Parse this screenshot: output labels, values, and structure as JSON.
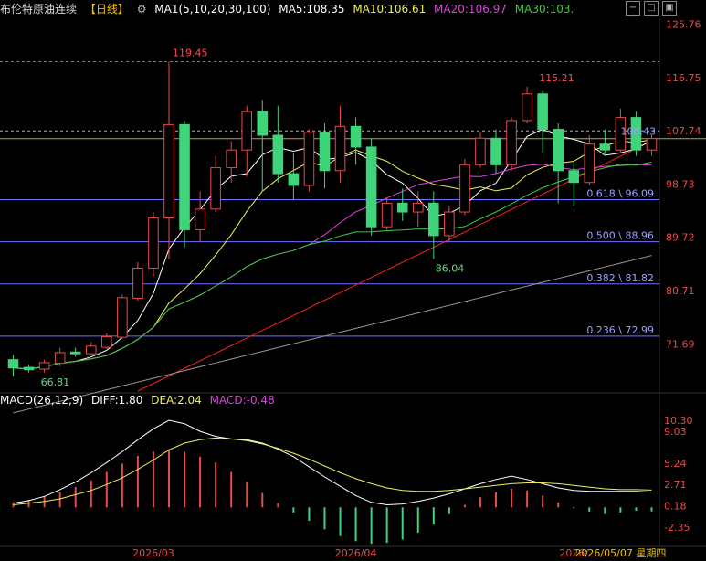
{
  "header": {
    "instrument": "布伦特原油连续",
    "period": "【日线】",
    "ma_label": "MA1(5,10,20,30,100)",
    "ma5": "MA5:108.35",
    "ma10": "MA10:106.61",
    "ma20": "MA20:106.97",
    "ma30": "MA30:103."
  },
  "macd_header": {
    "label": "MACD(26,12,9)",
    "diff": "DIFF:1.80",
    "dea": "DEA:2.04",
    "macd": "MACD:-0.48"
  },
  "colors": {
    "up": "#e84a4a",
    "down": "#3fd47a",
    "ma5": "#ffffff",
    "ma10": "#f2ef5a",
    "ma20": "#e040e0",
    "ma30": "#39cc39",
    "ma100": "#9a9a9a",
    "trend": "#ff2020",
    "fib": "#7070ff",
    "price_line": "#c8a040"
  },
  "chart_data": {
    "type": "candlestick",
    "price_axis_ticks": [
      "125.76",
      "116.75",
      "107.74",
      "98.73",
      "89.72",
      "80.71",
      "71.69"
    ],
    "price_axis_values": [
      125.76,
      116.75,
      107.74,
      98.73,
      89.72,
      80.71,
      71.69
    ],
    "ylim": [
      64.0,
      126.8
    ],
    "date_labels": [
      {
        "index": 9,
        "text": "2026/03"
      },
      {
        "index": 22,
        "text": "2026/04"
      },
      {
        "index": 36,
        "text": "2026/"
      },
      {
        "index": 39,
        "text": "2026/05/07 星期四"
      }
    ],
    "annotations": {
      "high": {
        "value": 119.45,
        "text": "119.45",
        "index": 10
      },
      "high2": {
        "value": 115.21,
        "text": "115.21",
        "index": 34
      },
      "low": {
        "value": 86.04,
        "text": "86.04",
        "index": 27
      },
      "low0": {
        "value": 66.81,
        "text": "66.81",
        "index": 2
      },
      "current": {
        "value": 106.43,
        "text": "106.43"
      }
    },
    "fib_levels": [
      {
        "value": 96.09,
        "text": "0.618 \\ 96.09"
      },
      {
        "value": 88.96,
        "text": "0.500 \\ 88.96"
      },
      {
        "value": 81.82,
        "text": "0.382 \\ 81.82"
      },
      {
        "value": 72.99,
        "text": "0.236 \\ 72.99"
      }
    ],
    "dashed_levels": [
      119.45,
      107.74
    ],
    "candles": [
      {
        "o": 69.0,
        "h": 69.8,
        "l": 66.2,
        "c": 67.6
      },
      {
        "o": 67.7,
        "h": 68.2,
        "l": 66.81,
        "c": 67.3
      },
      {
        "o": 67.4,
        "h": 69.0,
        "l": 66.81,
        "c": 68.5
      },
      {
        "o": 68.4,
        "h": 71.0,
        "l": 67.9,
        "c": 70.2
      },
      {
        "o": 70.3,
        "h": 71.0,
        "l": 69.5,
        "c": 70.0
      },
      {
        "o": 70.0,
        "h": 72.0,
        "l": 69.6,
        "c": 71.3
      },
      {
        "o": 71.1,
        "h": 73.5,
        "l": 70.8,
        "c": 72.9
      },
      {
        "o": 72.8,
        "h": 80.0,
        "l": 72.5,
        "c": 79.5
      },
      {
        "o": 79.4,
        "h": 85.5,
        "l": 79.0,
        "c": 84.5
      },
      {
        "o": 84.5,
        "h": 94.0,
        "l": 83.0,
        "c": 93.0
      },
      {
        "o": 93.0,
        "h": 119.45,
        "l": 86.0,
        "c": 108.8
      },
      {
        "o": 108.8,
        "h": 109.5,
        "l": 88.0,
        "c": 91.0
      },
      {
        "o": 91.0,
        "h": 97.5,
        "l": 89.0,
        "c": 94.5
      },
      {
        "o": 94.5,
        "h": 103.5,
        "l": 94.0,
        "c": 101.5
      },
      {
        "o": 101.5,
        "h": 106.0,
        "l": 99.0,
        "c": 104.5
      },
      {
        "o": 104.5,
        "h": 112.0,
        "l": 100.0,
        "c": 111.0
      },
      {
        "o": 111.0,
        "h": 113.0,
        "l": 97.5,
        "c": 107.0
      },
      {
        "o": 107.0,
        "h": 112.0,
        "l": 99.0,
        "c": 100.5
      },
      {
        "o": 100.5,
        "h": 104.0,
        "l": 96.0,
        "c": 98.5
      },
      {
        "o": 98.5,
        "h": 108.0,
        "l": 97.5,
        "c": 107.5
      },
      {
        "o": 107.5,
        "h": 109.0,
        "l": 98.0,
        "c": 101.0
      },
      {
        "o": 101.0,
        "h": 112.0,
        "l": 99.0,
        "c": 108.5
      },
      {
        "o": 108.5,
        "h": 110.0,
        "l": 102.0,
        "c": 105.0
      },
      {
        "o": 105.0,
        "h": 106.5,
        "l": 90.0,
        "c": 91.5
      },
      {
        "o": 91.5,
        "h": 96.5,
        "l": 91.0,
        "c": 95.5
      },
      {
        "o": 95.5,
        "h": 98.0,
        "l": 92.5,
        "c": 94.0
      },
      {
        "o": 94.0,
        "h": 97.5,
        "l": 91.5,
        "c": 95.5
      },
      {
        "o": 95.5,
        "h": 97.5,
        "l": 86.04,
        "c": 90.0
      },
      {
        "o": 90.0,
        "h": 95.0,
        "l": 89.0,
        "c": 94.0
      },
      {
        "o": 94.0,
        "h": 103.0,
        "l": 93.5,
        "c": 102.0
      },
      {
        "o": 102.0,
        "h": 107.5,
        "l": 101.5,
        "c": 106.5
      },
      {
        "o": 106.5,
        "h": 108.0,
        "l": 100.5,
        "c": 102.0
      },
      {
        "o": 102.0,
        "h": 110.0,
        "l": 101.0,
        "c": 109.5
      },
      {
        "o": 109.5,
        "h": 115.21,
        "l": 109.0,
        "c": 114.0
      },
      {
        "o": 114.0,
        "h": 114.5,
        "l": 104.0,
        "c": 108.0
      },
      {
        "o": 108.0,
        "h": 109.0,
        "l": 95.5,
        "c": 101.0
      },
      {
        "o": 101.0,
        "h": 102.5,
        "l": 95.0,
        "c": 99.0
      },
      {
        "o": 99.0,
        "h": 107.0,
        "l": 98.5,
        "c": 105.5
      },
      {
        "o": 105.5,
        "h": 108.0,
        "l": 103.5,
        "c": 104.5
      },
      {
        "o": 104.5,
        "h": 111.5,
        "l": 104.0,
        "c": 110.0
      },
      {
        "o": 110.0,
        "h": 111.0,
        "l": 103.5,
        "c": 104.5
      },
      {
        "o": 104.5,
        "h": 107.0,
        "l": 103.5,
        "c": 106.43
      }
    ],
    "macd_axis_ticks": [
      "10.30",
      "9.03",
      "5.24",
      "2.71",
      "0.18",
      "-2.35"
    ],
    "macd_axis_values": [
      10.3,
      9.03,
      5.24,
      2.71,
      0.18,
      -2.35
    ],
    "macd_ylim": [
      -4.4,
      11.6
    ],
    "macd_hist": [
      0.6,
      0.9,
      1.3,
      1.8,
      2.4,
      3.2,
      4.2,
      5.2,
      6.1,
      6.6,
      6.9,
      6.6,
      6.0,
      5.3,
      4.2,
      3.0,
      1.7,
      0.5,
      -0.6,
      -1.6,
      -2.6,
      -3.4,
      -4.0,
      -4.3,
      -4.2,
      -3.8,
      -3.0,
      -2.0,
      -0.8,
      0.3,
      1.2,
      1.8,
      2.2,
      2.0,
      1.4,
      0.6,
      -0.1,
      -0.5,
      -0.8,
      -0.6,
      -0.4,
      -0.48
    ],
    "macd_diff": [
      0.5,
      0.8,
      1.3,
      2.1,
      3.0,
      4.1,
      5.3,
      6.6,
      8.0,
      9.3,
      10.3,
      9.9,
      9.0,
      8.4,
      8.1,
      8.0,
      7.6,
      6.9,
      6.0,
      4.8,
      3.6,
      2.5,
      1.4,
      0.6,
      0.3,
      0.4,
      0.7,
      1.1,
      1.6,
      2.2,
      2.8,
      3.3,
      3.7,
      3.3,
      2.8,
      2.3,
      2.0,
      1.9,
      1.9,
      1.9,
      1.9,
      1.8
    ],
    "macd_dea": [
      0.3,
      0.5,
      0.7,
      1.0,
      1.5,
      2.0,
      2.7,
      3.5,
      4.5,
      5.6,
      6.8,
      7.6,
      8.0,
      8.2,
      8.1,
      7.9,
      7.5,
      7.0,
      6.4,
      5.7,
      4.9,
      4.1,
      3.4,
      2.8,
      2.3,
      2.0,
      1.9,
      1.9,
      2.0,
      2.2,
      2.4,
      2.6,
      2.8,
      2.9,
      2.9,
      2.8,
      2.6,
      2.4,
      2.2,
      2.1,
      2.1,
      2.04
    ]
  }
}
